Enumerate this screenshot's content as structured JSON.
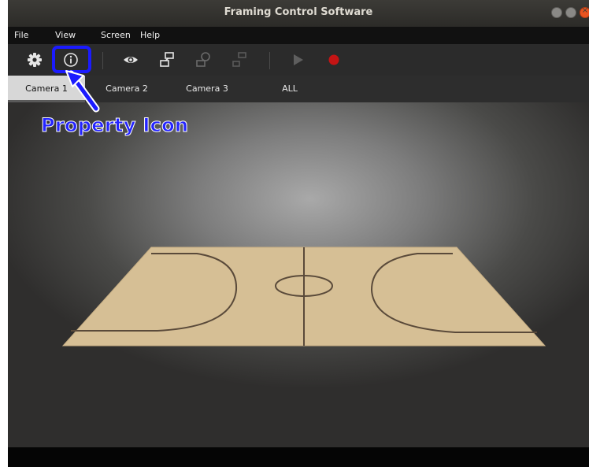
{
  "window": {
    "title": "Framing Control Software",
    "close_glyph": "×"
  },
  "menu": {
    "items": [
      "File",
      "View",
      "Screen",
      "Help"
    ]
  },
  "toolbar": {
    "buttons": [
      {
        "icon": "gear-icon"
      },
      {
        "icon": "info-icon",
        "highlighted": true
      },
      {
        "icon": "eye-icon"
      },
      {
        "icon": "layout-icon"
      },
      {
        "icon": "layout-rotate-icon",
        "disabled": true
      },
      {
        "icon": "layout-small-icon",
        "disabled": true
      },
      {
        "icon": "play-icon",
        "disabled": true
      },
      {
        "icon": "record-icon"
      }
    ]
  },
  "tabs": {
    "items": [
      "Camera 1",
      "Camera 2",
      "Camera 3",
      "ALL"
    ],
    "active": "Camera 1"
  },
  "annotation": {
    "label": "Property Icon",
    "color": "#1b1bff"
  },
  "colors": {
    "court": "#d6bf95",
    "court_line": "#5a4a3a",
    "record": "#cc1111",
    "accent_close": "#e95420"
  }
}
